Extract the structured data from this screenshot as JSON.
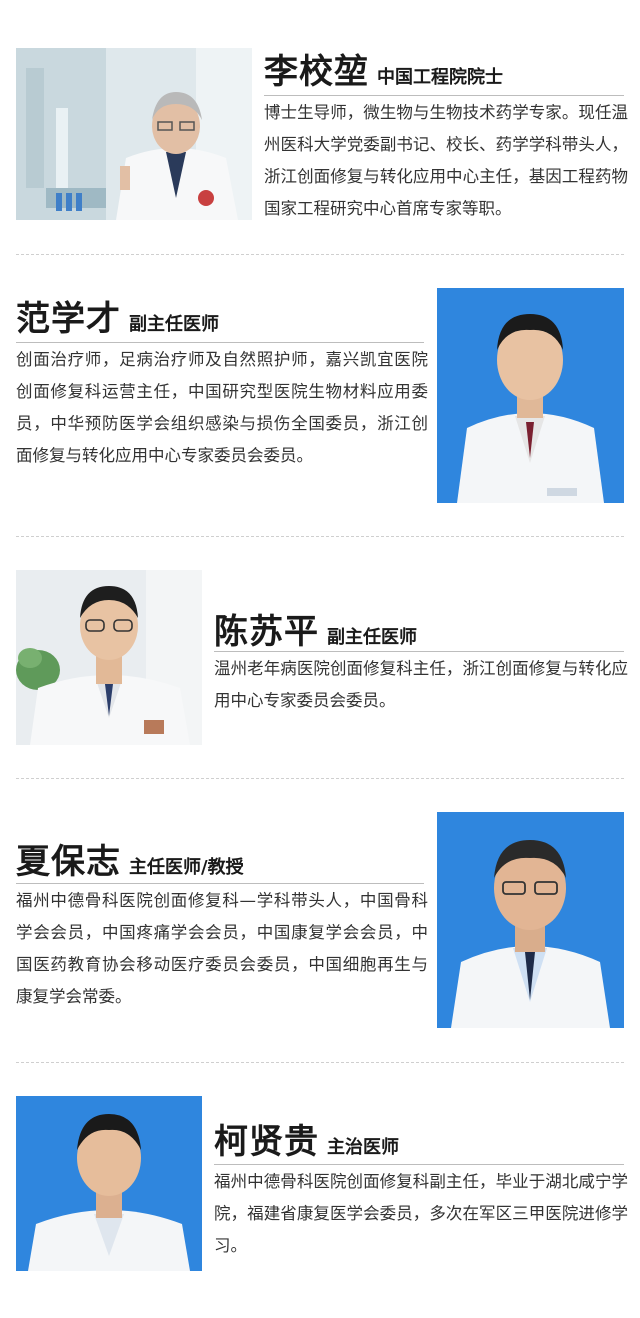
{
  "experts": [
    {
      "name": "李校堃",
      "title": "中国工程院院士",
      "bio": "博士生导师，微生物与生物技术药学专家。现任温州医科大学党委副书记、校长、药学学科带头人，浙江创面修复与转化应用中心主任，基因工程药物国家工程研究中心首席专家等职。",
      "photo": "portrait-lab"
    },
    {
      "name": "范学才",
      "title": "副主任医师",
      "bio": "创面治疗师，足病治疗师及自然照护师，嘉兴凯宜医院创面修复科运营主任，中国研究型医院生物材料应用委员，中华预防医学会组织感染与损伤全国委员，浙江创面修复与转化应用中心专家委员会委员。",
      "photo": "portrait-blue"
    },
    {
      "name": "陈苏平",
      "title": "副主任医师",
      "bio": "温州老年病医院创面修复科主任，浙江创面修复与转化应用中心专家委员会委员。",
      "photo": "portrait-office"
    },
    {
      "name": "夏保志",
      "title": "主任医师/教授",
      "bio": "福州中德骨科医院创面修复科—学科带头人，中国骨科学会会员，中国疼痛学会会员，中国康复学会会员，中国医药教育协会移动医疗委员会委员，中国细胞再生与康复学会常委。",
      "photo": "portrait-blue"
    },
    {
      "name": "柯贤贵",
      "title": "主治医师",
      "bio": "福州中德骨科医院创面修复科副主任，毕业于湖北咸宁学院，福建省康复医学会委员，多次在军区三甲医院进修学习。",
      "photo": "portrait-blue"
    }
  ],
  "colors": {
    "photo_blue": "#2f86de",
    "coat_white": "#f4f6f8",
    "rule": "#bdbdbd"
  }
}
